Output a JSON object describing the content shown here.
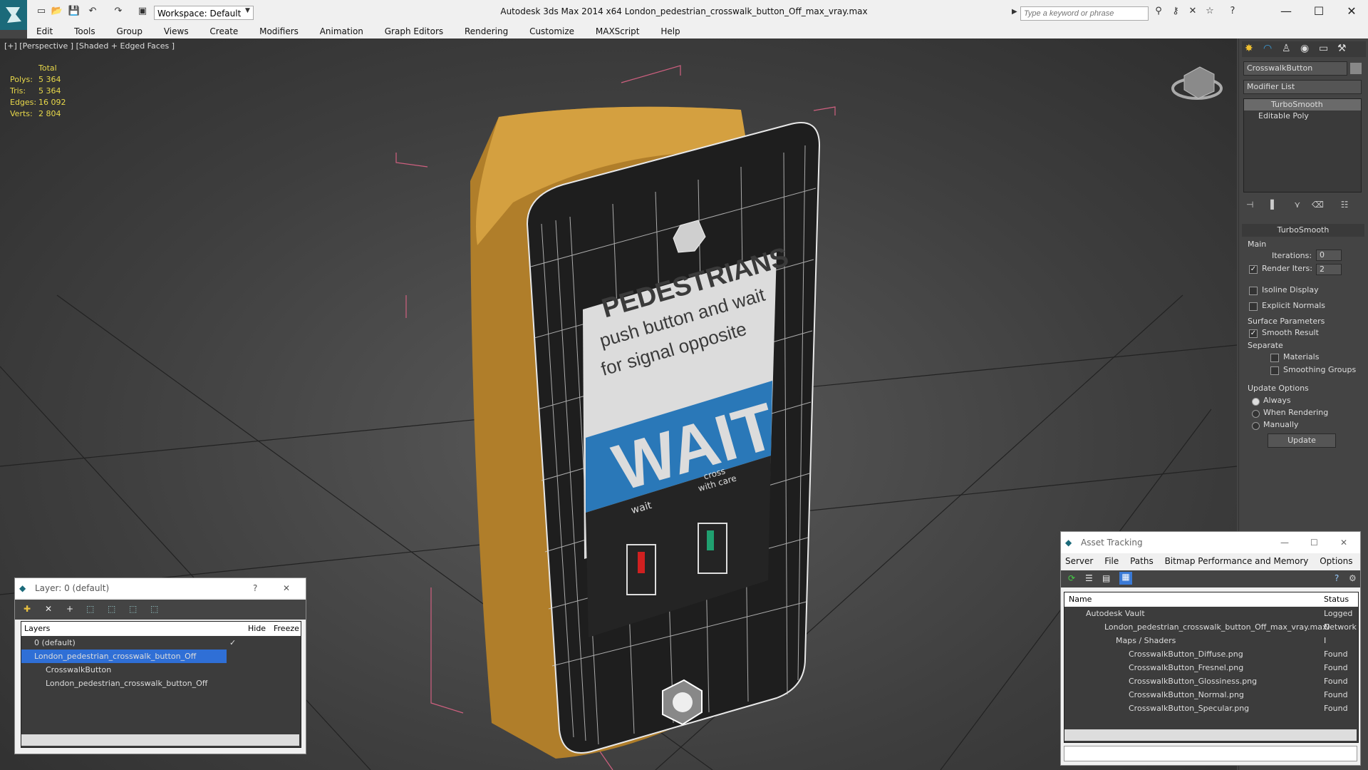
{
  "window": {
    "title": "Autodesk 3ds Max  2014 x64      London_pedestrian_crosswalk_button_Off_max_vray.max",
    "workspace": "Workspace: Default",
    "search_placeholder": "Type a keyword or phrase"
  },
  "menu": [
    "Edit",
    "Tools",
    "Group",
    "Views",
    "Create",
    "Modifiers",
    "Animation",
    "Graph Editors",
    "Rendering",
    "Customize",
    "MAXScript",
    "Help"
  ],
  "viewport": {
    "label": "[+] [Perspective ] [Shaded + Edged Faces ]",
    "stats": {
      "header": "Total",
      "rows": [
        {
          "k": "Polys:",
          "v": "5 364"
        },
        {
          "k": "Tris:",
          "v": "5 364"
        },
        {
          "k": "Edges:",
          "v": "16 092"
        },
        {
          "k": "Verts:",
          "v": "2 804"
        }
      ]
    },
    "sign": {
      "line1": "PEDESTRIANS",
      "line2": "push button and wait",
      "line3": "for signal opposite",
      "wait": "WAIT",
      "left_label": "wait",
      "right_label": "cross with care"
    }
  },
  "command_panel": {
    "object_name": "CrosswalkButton",
    "modifier_list": "Modifier List",
    "stack": [
      "TurboSmooth",
      "Editable Poly"
    ],
    "rollout_title": "TurboSmooth",
    "main_label": "Main",
    "iterations_label": "Iterations:",
    "iterations_value": "0",
    "render_iters_label": "Render Iters:",
    "render_iters_value": "2",
    "isoline": "Isoline Display",
    "explicit": "Explicit Normals",
    "surface_params": "Surface Parameters",
    "smooth_result": "Smooth Result",
    "separate": "Separate",
    "materials": "Materials",
    "smoothing_groups": "Smoothing Groups",
    "update_options": "Update Options",
    "always": "Always",
    "when_rendering": "When Rendering",
    "manually": "Manually",
    "update_button": "Update"
  },
  "layer_dialog": {
    "title": "Layer: 0 (default)",
    "help": "?",
    "close": "✕",
    "col_layers": "Layers",
    "col_hide": "Hide",
    "col_freeze": "Freeze",
    "rows": [
      {
        "name": "0 (default)",
        "indent": 0
      },
      {
        "name": "London_pedestrian_crosswalk_button_Off",
        "indent": 0,
        "selected": true
      },
      {
        "name": "CrosswalkButton",
        "indent": 1
      },
      {
        "name": "London_pedestrian_crosswalk_button_Off",
        "indent": 1
      }
    ]
  },
  "asset_dialog": {
    "title": "Asset Tracking",
    "menu": [
      "Server",
      "File",
      "Paths",
      "Bitmap Performance and Memory",
      "Options"
    ],
    "col_name": "Name",
    "col_status": "Status",
    "rows": [
      {
        "name": "Autodesk Vault",
        "status": "Logged O",
        "indent": 1
      },
      {
        "name": "London_pedestrian_crosswalk_button_Off_max_vray.max",
        "status": "Network I",
        "indent": 2
      },
      {
        "name": "Maps / Shaders",
        "status": "",
        "indent": 3
      },
      {
        "name": "CrosswalkButton_Diffuse.png",
        "status": "Found",
        "indent": 4
      },
      {
        "name": "CrosswalkButton_Fresnel.png",
        "status": "Found",
        "indent": 4
      },
      {
        "name": "CrosswalkButton_Glossiness.png",
        "status": "Found",
        "indent": 4
      },
      {
        "name": "CrosswalkButton_Normal.png",
        "status": "Found",
        "indent": 4
      },
      {
        "name": "CrosswalkButton_Specular.png",
        "status": "Found",
        "indent": 4
      }
    ]
  }
}
